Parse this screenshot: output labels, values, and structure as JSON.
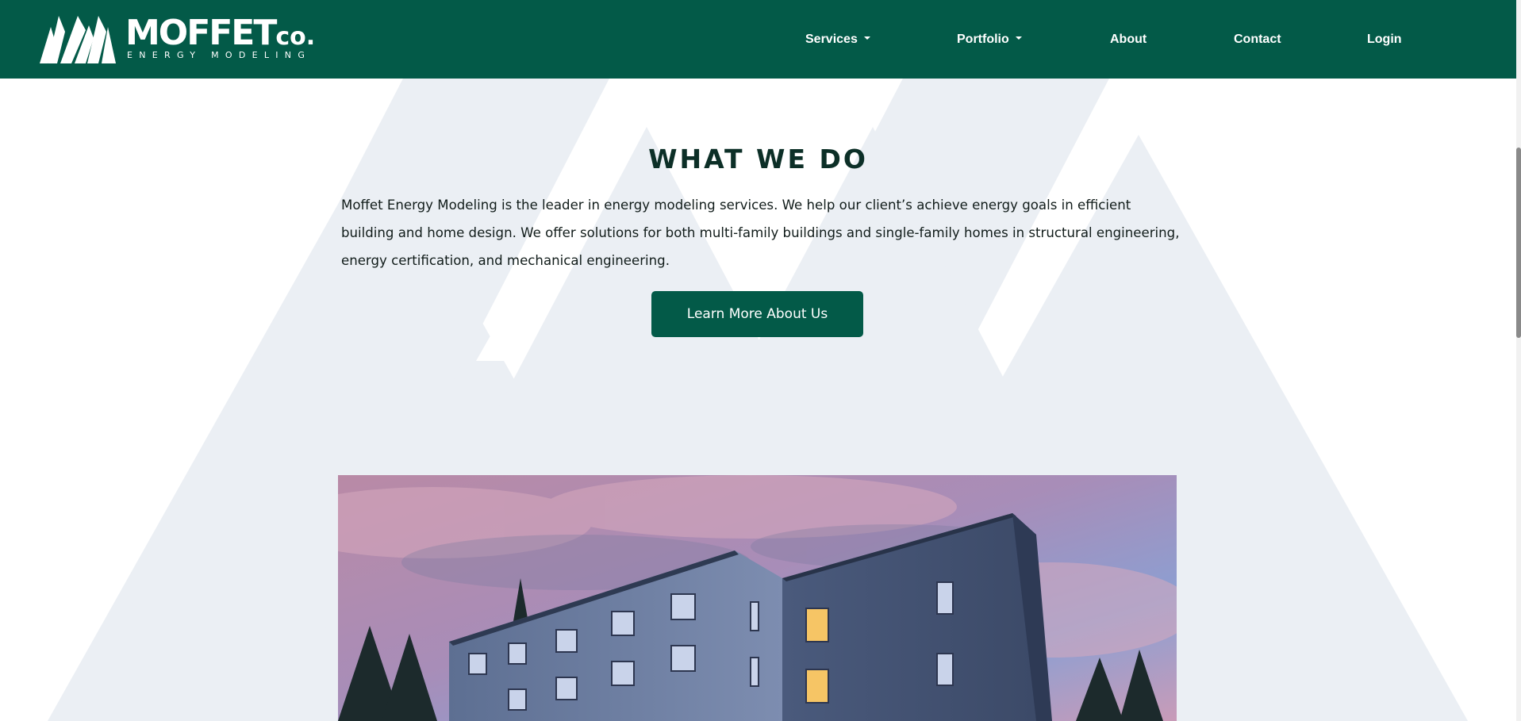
{
  "header": {
    "logo": {
      "name": "MOFFET",
      "suffix": "co.",
      "tagline": "ENERGY MODELING"
    },
    "nav": [
      {
        "label": "Services",
        "dropdown": true
      },
      {
        "label": "Portfolio",
        "dropdown": true
      },
      {
        "label": "About",
        "dropdown": false
      },
      {
        "label": "Contact",
        "dropdown": false
      },
      {
        "label": "Login",
        "dropdown": false
      }
    ]
  },
  "main": {
    "section_title": "WHAT WE DO",
    "section_body": "Moffet Energy Modeling is the leader in energy modeling services. We help our client’s achieve energy goals in efficient building and home design. We offer solutions for both multi-family buildings and single-family homes in structural engineering, energy certification, and mechanical engineering.",
    "cta_label": "Learn More About Us"
  },
  "icons": {
    "logo_mark": "mountain-logo-icon",
    "dropdown": "caret-down-icon"
  },
  "colors": {
    "brand": "#035a48",
    "heading": "#0c2f27",
    "pattern": "#ebeff4"
  }
}
